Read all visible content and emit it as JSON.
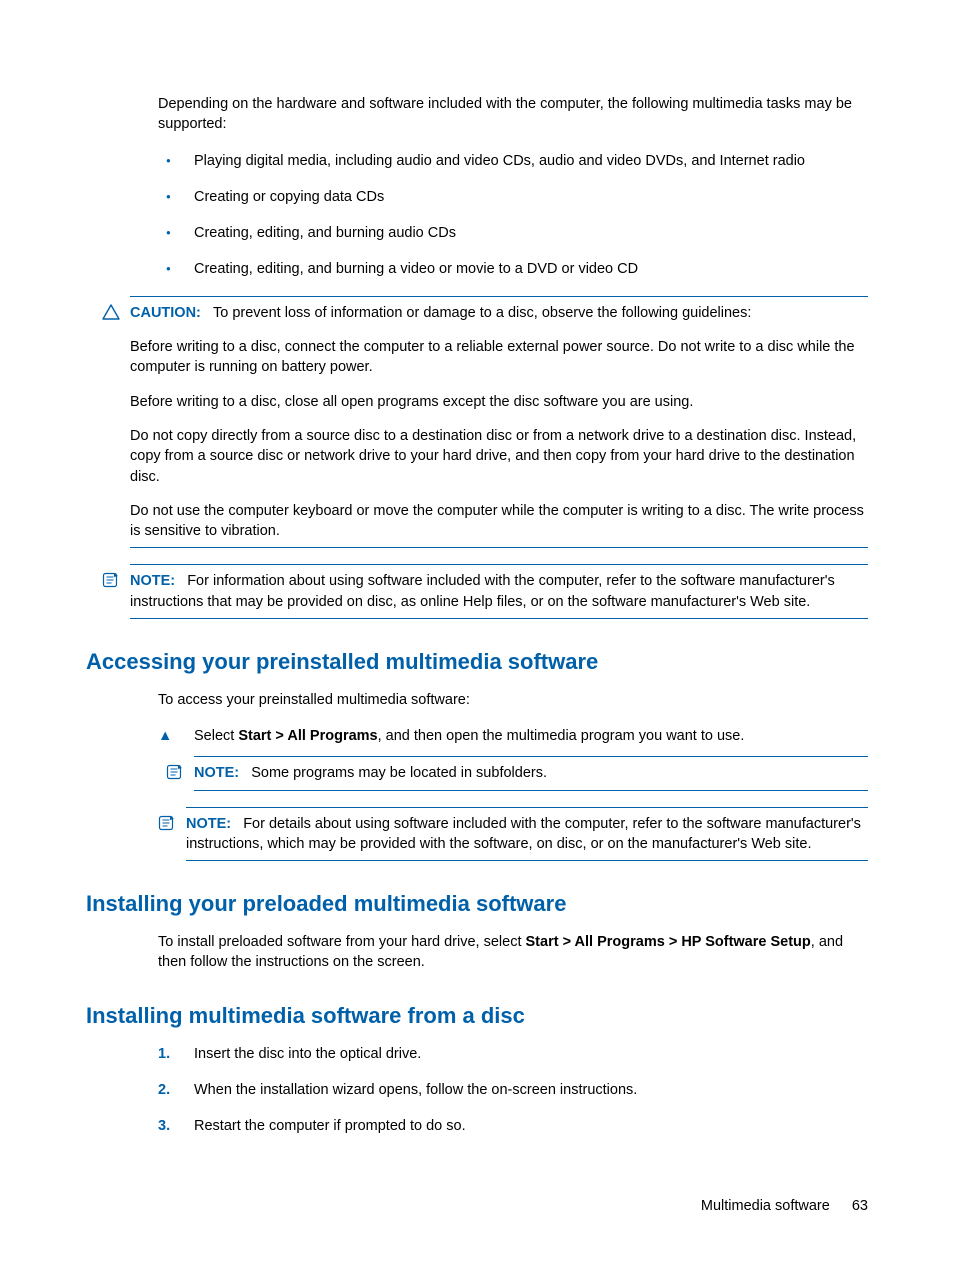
{
  "intro": "Depending on the hardware and software included with the computer, the following multimedia tasks may be supported:",
  "bullets": [
    "Playing digital media, including audio and video CDs, audio and video DVDs, and Internet radio",
    "Creating or copying data CDs",
    "Creating, editing, and burning audio CDs",
    "Creating, editing, and burning a video or movie to a DVD or video CD"
  ],
  "caution": {
    "label": "CAUTION:",
    "lead": "To prevent loss of information or damage to a disc, observe the following guidelines:",
    "paras": [
      "Before writing to a disc, connect the computer to a reliable external power source. Do not write to a disc while the computer is running on battery power.",
      "Before writing to a disc, close all open programs except the disc software you are using.",
      "Do not copy directly from a source disc to a destination disc or from a network drive to a destination disc. Instead, copy from a source disc or network drive to your hard drive, and then copy from your hard drive to the destination disc.",
      "Do not use the computer keyboard or move the computer while the computer is writing to a disc. The write process is sensitive to vibration."
    ]
  },
  "note1": {
    "label": "NOTE:",
    "text": "For information about using software included with the computer, refer to the software manufacturer's instructions that may be provided on disc, as online Help files, or on the software manufacturer's Web site."
  },
  "s1": {
    "heading": "Accessing your preinstalled multimedia software",
    "intro": "To access your preinstalled multimedia software:",
    "step_pre": "Select ",
    "step_bold": "Start > All Programs",
    "step_post": ", and then open the multimedia program you want to use.",
    "note_inner": {
      "label": "NOTE:",
      "text": "Some programs may be located in subfolders."
    },
    "note_outer": {
      "label": "NOTE:",
      "text": "For details about using software included with the computer, refer to the software manufacturer's instructions, which may be provided with the software, on disc, or on the manufacturer's Web site."
    }
  },
  "s2": {
    "heading": "Installing your preloaded multimedia software",
    "text_pre": "To install preloaded software from your hard drive, select ",
    "text_bold": "Start > All Programs > HP Software Setup",
    "text_post": ", and then follow the instructions on the screen."
  },
  "s3": {
    "heading": "Installing multimedia software from a disc",
    "steps": [
      "Insert the disc into the optical drive.",
      "When the installation wizard opens, follow the on-screen instructions.",
      "Restart the computer if prompted to do so."
    ]
  },
  "footer": {
    "title": "Multimedia software",
    "page": "63"
  }
}
